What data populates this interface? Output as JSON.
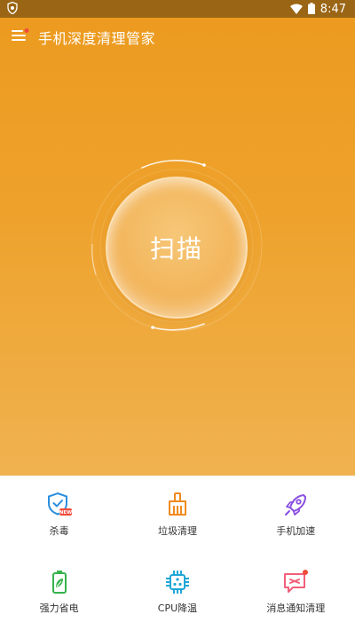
{
  "status_bar": {
    "time": "8:47",
    "icons": [
      "shield-app-icon",
      "wifi-icon",
      "battery-icon"
    ]
  },
  "app_bar": {
    "title": "手机深度清理管家",
    "menu_icon": "menu-icon",
    "has_notification_dot": true
  },
  "scan": {
    "label": "扫描"
  },
  "features": [
    {
      "label": "杀毒",
      "icon": "shield-check-icon",
      "badge": "NEW"
    },
    {
      "label": "垃圾清理",
      "icon": "broom-icon"
    },
    {
      "label": "手机加速",
      "icon": "rocket-icon"
    },
    {
      "label": "强力省电",
      "icon": "battery-leaf-icon"
    },
    {
      "label": "CPU降温",
      "icon": "cpu-icon"
    },
    {
      "label": "消息通知清理",
      "icon": "message-icon",
      "has_dot": true
    }
  ],
  "colors": {
    "primary": "#EC9A1E",
    "status_bar": "#9A6514",
    "icon_blue": "#2A8FE0",
    "icon_orange": "#F08A1E",
    "icon_purple": "#8A4FE0",
    "icon_green": "#36B24A",
    "icon_teal": "#1FA7D8",
    "icon_pink": "#F0607A",
    "badge_red": "#F04A3A"
  }
}
